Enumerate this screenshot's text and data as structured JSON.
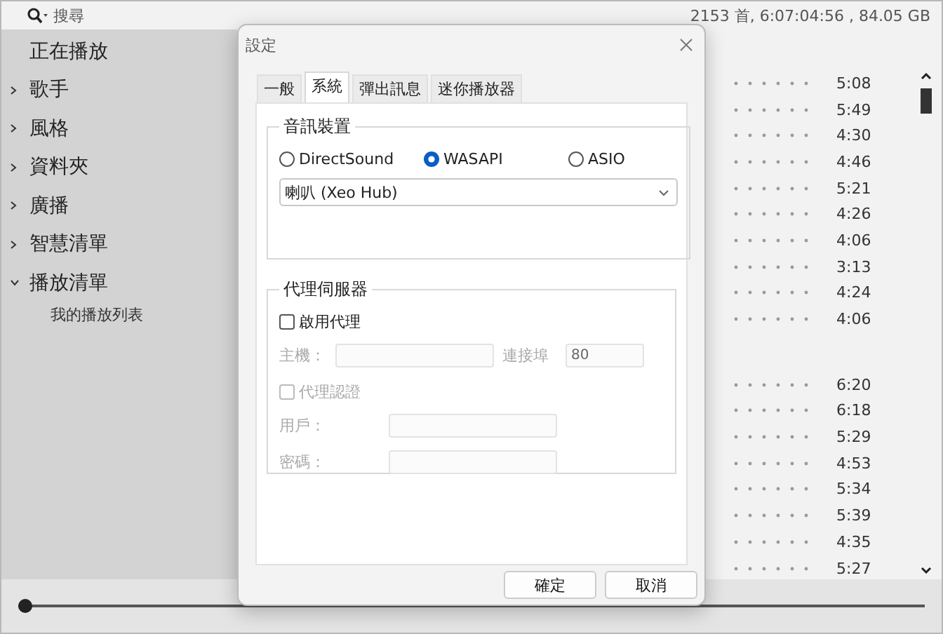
{
  "search": {
    "label": "搜尋"
  },
  "library_stats": "2153 首, 6:07:04:56 , 84.05 GB",
  "sidebar": {
    "items": [
      {
        "label": "正在播放"
      },
      {
        "label": "歌手",
        "expanded": false
      },
      {
        "label": "風格",
        "expanded": false
      },
      {
        "label": "資料夾",
        "expanded": false
      },
      {
        "label": "廣播",
        "expanded": false
      },
      {
        "label": "智慧清單",
        "expanded": false
      },
      {
        "label": "播放清單",
        "expanded": true,
        "children": [
          {
            "label": "我的播放列表"
          }
        ]
      }
    ]
  },
  "track_groups": [
    [
      "5:08",
      "5:49",
      "4:30",
      "4:46",
      "5:21",
      "4:26",
      "4:06",
      "3:13",
      "4:24",
      "4:06"
    ],
    [
      "6:20",
      "6:18",
      "5:29",
      "4:53",
      "5:34",
      "5:39",
      "4:35",
      "5:27"
    ]
  ],
  "seek": {
    "level": 0
  },
  "dialog": {
    "title": "設定",
    "tabs": [
      {
        "label": "一般",
        "selected": false
      },
      {
        "label": "系統",
        "selected": true
      },
      {
        "label": "彈出訊息",
        "selected": false
      },
      {
        "label": "迷你播放器",
        "selected": false
      }
    ],
    "audio_device": {
      "title": "音訊裝置",
      "outputs": [
        {
          "label": "DirectSound",
          "selected": false
        },
        {
          "label": "WASAPI",
          "selected": true
        },
        {
          "label": "ASIO",
          "selected": false
        }
      ],
      "device": "喇叭 (Xeo Hub)"
    },
    "proxy": {
      "title": "代理伺服器",
      "enable": {
        "label": "啟用代理",
        "checked": false,
        "disabled": false
      },
      "host": {
        "label": "主機：",
        "disabled": true
      },
      "port": {
        "label": "連接埠",
        "value": "80",
        "disabled": true
      },
      "auth": {
        "label": "代理認證",
        "checked": false,
        "disabled": true
      },
      "user": {
        "label": "用戶：",
        "disabled": true
      },
      "password": {
        "label": "密碼：",
        "disabled": true
      }
    },
    "buttons": [
      "確定",
      "取消"
    ]
  }
}
